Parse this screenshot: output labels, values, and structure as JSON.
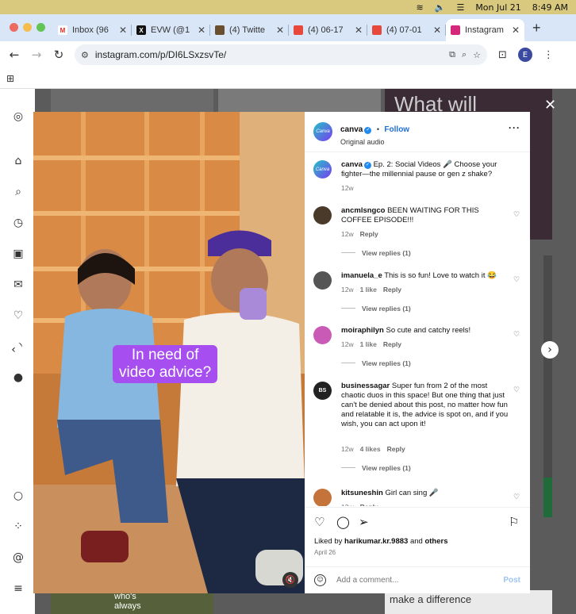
{
  "menubar": {
    "date": "Mon Jul 21",
    "time": "8:49 AM"
  },
  "tabs": [
    {
      "label": "Inbox (96",
      "fav_color": "#ffffff",
      "fav_glyph": "M",
      "fav_text_color": "#d93025"
    },
    {
      "label": "EVW (@1",
      "fav_color": "#111111",
      "fav_glyph": "X",
      "fav_text_color": "#ffffff"
    },
    {
      "label": "(4) Twitte",
      "fav_color": "#6a4f2e",
      "fav_glyph": "",
      "fav_text_color": "#ffffff"
    },
    {
      "label": "(4) 06-17",
      "fav_color": "#e8483b",
      "fav_glyph": "",
      "fav_text_color": "#ffffff"
    },
    {
      "label": "(4) 07-01",
      "fav_color": "#e8483b",
      "fav_glyph": "",
      "fav_text_color": "#ffffff"
    },
    {
      "label": "Instagram",
      "fav_color": "#d6287a",
      "fav_glyph": "",
      "fav_text_color": "#ffffff",
      "active": true
    }
  ],
  "toolbar": {
    "url": "instagram.com/p/DI6LSxzsvTe/",
    "avatar_letter": "E"
  },
  "post": {
    "author": "canva",
    "follow_label": "Follow",
    "audio": "Original audio",
    "caption_user": "canva",
    "caption_text": "Ep. 2: Social Videos 🎤 Choose your fighter—the millennial pause or gen z shake?",
    "caption_time": "12w",
    "logo_text": "Canva",
    "video_caption_line1": "In need of",
    "video_caption_line2": "video advice?",
    "likes_prefix": "Liked by",
    "likes_user": "harikumar.kr.9883",
    "likes_and": "and",
    "likes_others": "others",
    "date": "April 26",
    "add_comment_placeholder": "Add a comment...",
    "post_label": "Post"
  },
  "comments": [
    {
      "user": "ancmlsngco",
      "text": "BEEN WAITING FOR THIS COFFEE EPISODE!!!",
      "time": "12w",
      "likes": "",
      "reply": "Reply",
      "view_replies": "View replies (1)",
      "avatar_color": "#4a3a2a"
    },
    {
      "user": "imanuela_e",
      "text": "This is so fun! Love to watch it 😂",
      "time": "12w",
      "likes": "1 like",
      "reply": "Reply",
      "view_replies": "View replies (1)",
      "avatar_color": "#555555"
    },
    {
      "user": "moiraphilyn",
      "text": "So cute and catchy reels!",
      "time": "12w",
      "likes": "1 like",
      "reply": "Reply",
      "view_replies": "View replies (1)",
      "avatar_color": "#c95bb6"
    },
    {
      "user": "businessagar",
      "text": "Super fun from 2 of the most chaotic duos in this space! But one thing that just can't be denied about this post, no matter how fun and relatable it is, the advice is spot on, and if you wish, you can act upon it!",
      "time": "12w",
      "likes": "4 likes",
      "reply": "Reply",
      "view_replies": "View replies (1)",
      "avatar_color": "#222222",
      "avatar_text": "BS"
    },
    {
      "user": "kitsuneshin",
      "text": "Girl can sing 🎤",
      "time": "12w",
      "likes": "",
      "reply": "Reply",
      "view_replies": "",
      "avatar_color": "#c4733a"
    }
  ],
  "background": {
    "tile_text": "What will",
    "bottom_text_1": "who's",
    "bottom_text_2": "always",
    "bottom_text_3": "make a difference"
  }
}
